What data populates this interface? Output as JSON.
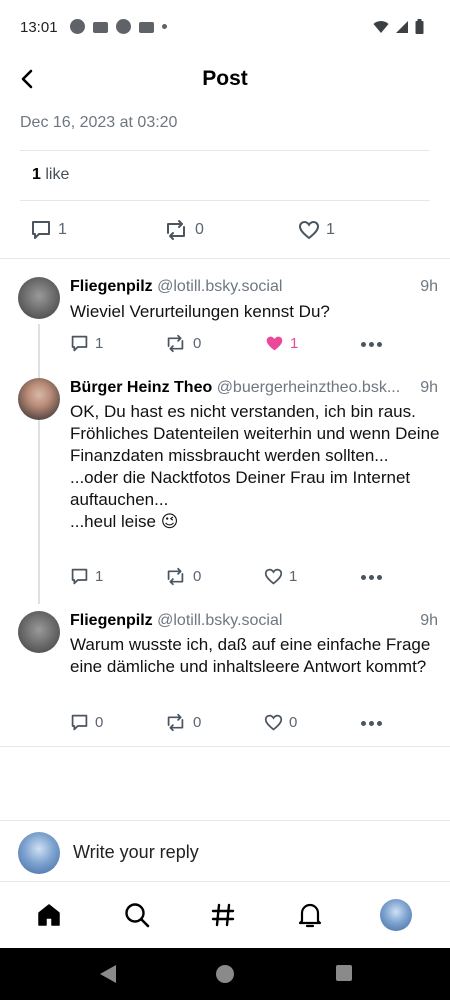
{
  "status_bar": {
    "time": "13:01"
  },
  "header": {
    "title": "Post",
    "back_icon": "chevron-left-icon"
  },
  "post": {
    "date": "Dec 16, 2023 at 03:20",
    "likes_count": "1",
    "likes_label": "like",
    "actions": {
      "reply_count": "1",
      "repost_count": "0",
      "like_count": "1"
    }
  },
  "replies": [
    {
      "name": "Fliegenpilz",
      "handle": "@lotill.bsky.social",
      "time": "9h",
      "text": "Wieviel Verurteilungen kennst Du?",
      "reply_count": "1",
      "repost_count": "0",
      "like_count": "1",
      "liked": true
    },
    {
      "name": "Bürger Heinz Theo",
      "handle": "@buergerheinztheo.bsk...",
      "time": "9h",
      "text": "OK, Du hast es nicht verstanden, ich bin raus.\nFröhliches Datenteilen weiterhin und wenn Deine Finanzdaten missbraucht werden sollten...\n...oder die Nacktfotos Deiner Frau im Internet auftauchen...\n...heul leise 😉",
      "reply_count": "1",
      "repost_count": "0",
      "like_count": "1",
      "liked": false
    },
    {
      "name": "Fliegenpilz",
      "handle": "@lotill.bsky.social",
      "time": "9h",
      "text": "Warum wusste ich, daß auf eine einfache Frage eine dämliche und inhaltsleere Antwort kommt?",
      "reply_count": "0",
      "repost_count": "0",
      "like_count": "0",
      "liked": false
    }
  ],
  "composer": {
    "placeholder": "Write your reply"
  },
  "bottom_nav": [
    "home-icon",
    "search-icon",
    "hashtag-icon",
    "bell-icon",
    "profile-avatar"
  ],
  "colors": {
    "like_active": "#ec4899",
    "muted": "#6e7781",
    "divider": "#e4e7eb"
  }
}
